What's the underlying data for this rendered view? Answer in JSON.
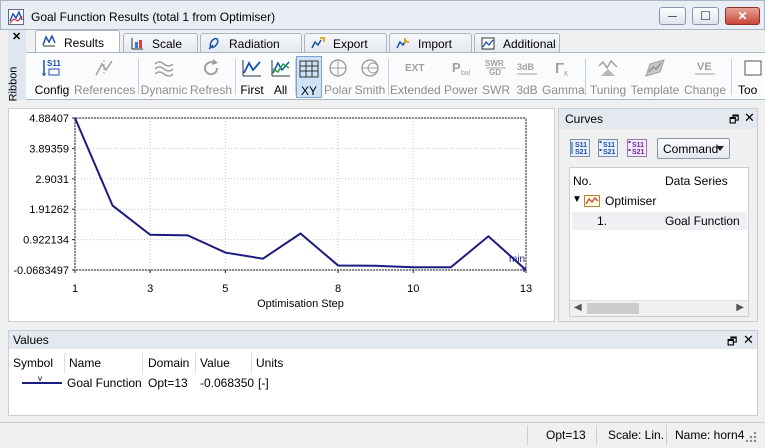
{
  "window": {
    "title": "Goal Function Results (total 1 from Optimiser)",
    "minimize": "─",
    "maximize": "☐",
    "close": "✕"
  },
  "ribbon": {
    "close_x": "✕",
    "side_label": "Ribbon",
    "tabs": [
      "Results",
      "Scale",
      "Radiation",
      "Export",
      "Import",
      "Additional"
    ],
    "tools": [
      {
        "label": "Config",
        "state": "enabled",
        "icon": "s11-config-icon",
        "icon_text": "S11"
      },
      {
        "label": "References",
        "state": "disabled",
        "icon": "references-icon"
      },
      {
        "label": "Dynamic",
        "state": "disabled",
        "icon": "dynamic-icon"
      },
      {
        "label": "Refresh",
        "state": "disabled",
        "icon": "refresh-icon"
      },
      {
        "label": "First",
        "state": "enabled",
        "icon": "first-icon"
      },
      {
        "label": "All",
        "state": "enabled",
        "icon": "all-icon"
      },
      {
        "label": "XY",
        "state": "pressed",
        "icon": "xy-grid-icon"
      },
      {
        "label": "Polar",
        "state": "disabled",
        "icon": "polar-icon"
      },
      {
        "label": "Smith",
        "state": "disabled",
        "icon": "smith-icon"
      },
      {
        "label": "Extended",
        "state": "disabled",
        "icon": "ext-icon",
        "icon_text": "EXT"
      },
      {
        "label": "Power",
        "state": "disabled",
        "icon": "power-icon",
        "icon_text": "P",
        "icon_sub": "bal"
      },
      {
        "label": "SWR",
        "state": "disabled",
        "icon": "swr-icon",
        "icon_text": "SWR",
        "icon_sub": "GD"
      },
      {
        "label": "3dB",
        "state": "disabled",
        "icon": "3db-icon",
        "icon_text": "3dB"
      },
      {
        "label": "Gamma",
        "state": "disabled",
        "icon": "gamma-icon",
        "icon_text": "Γ",
        "icon_sub": "K"
      },
      {
        "label": "Tuning",
        "state": "disabled",
        "icon": "tuning-icon"
      },
      {
        "label": "Template",
        "state": "disabled",
        "icon": "template-icon"
      },
      {
        "label": "Change",
        "state": "disabled",
        "icon": "change-icon",
        "icon_text": "VE"
      },
      {
        "label": "Too",
        "state": "enabled",
        "icon": "tools-icon"
      }
    ]
  },
  "curves_pane": {
    "title": "Curves",
    "pin": "🗗",
    "close": "✕",
    "command_label": "Command",
    "columns": [
      "No.",
      "Data Series"
    ],
    "group_label": "Optimiser",
    "rows": [
      {
        "no": "1.",
        "series": "Goal Function"
      }
    ],
    "scroll_left": "◀",
    "scroll_right": "▶"
  },
  "values_pane": {
    "title": "Values",
    "pin": "🗗",
    "close": "✕",
    "columns": [
      "Symbol",
      "Name",
      "Domain",
      "Value",
      "Units"
    ],
    "symbol_marker": "v",
    "row": {
      "name": "Goal Function",
      "domain": "Opt=13",
      "value": "-0.068350",
      "units": "[-]"
    }
  },
  "status": {
    "opt": "Opt=13",
    "scale": "Scale: Lin.",
    "name": "Name: horn4"
  },
  "chart_data": {
    "type": "line",
    "title": "",
    "xlabel": "Optimisation Step",
    "ylabel": "",
    "xlim": [
      1,
      13
    ],
    "ylim": [
      -0.0683497,
      4.88407
    ],
    "xticks": [
      1,
      3,
      5,
      8,
      10,
      13
    ],
    "xtick_labels": [
      "1",
      "3",
      "5",
      "8",
      "10",
      "13"
    ],
    "yticks": [
      4.88407,
      3.89359,
      2.9031,
      1.91262,
      0.922134,
      -0.0683497
    ],
    "ytick_labels": [
      "4.88407",
      "3.89359",
      "2.9031",
      "1.91262",
      "0.922134",
      "-0.0683497"
    ],
    "grid": true,
    "series": [
      {
        "name": "Goal Function",
        "color": "#1b1b80",
        "x": [
          1,
          2,
          3,
          4,
          5,
          6,
          7,
          8,
          9,
          10,
          11,
          12,
          13
        ],
        "y": [
          4.88407,
          2.03,
          1.08,
          1.06,
          0.5,
          0.3,
          1.12,
          0.08,
          0.07,
          0.02,
          0.02,
          1.03,
          -0.0683497
        ]
      }
    ],
    "annotation": "min"
  }
}
